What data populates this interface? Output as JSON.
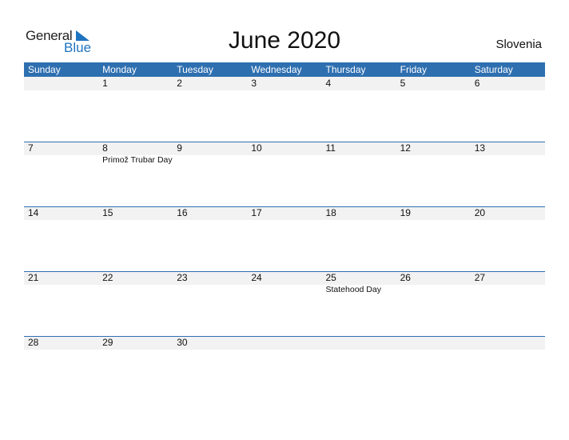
{
  "logo": {
    "general": "General",
    "blue": "Blue"
  },
  "header": {
    "title": "June 2020",
    "country": "Slovenia"
  },
  "colors": {
    "accent": "#2e6fb0",
    "band": "#f2f2f2",
    "logo_blue": "#1e74c0"
  },
  "weekdays": [
    "Sunday",
    "Monday",
    "Tuesday",
    "Wednesday",
    "Thursday",
    "Friday",
    "Saturday"
  ],
  "weeks": [
    [
      {
        "d": ""
      },
      {
        "d": "1"
      },
      {
        "d": "2"
      },
      {
        "d": "3"
      },
      {
        "d": "4"
      },
      {
        "d": "5"
      },
      {
        "d": "6"
      }
    ],
    [
      {
        "d": "7"
      },
      {
        "d": "8",
        "e": "Primož Trubar Day"
      },
      {
        "d": "9"
      },
      {
        "d": "10"
      },
      {
        "d": "11"
      },
      {
        "d": "12"
      },
      {
        "d": "13"
      }
    ],
    [
      {
        "d": "14"
      },
      {
        "d": "15"
      },
      {
        "d": "16"
      },
      {
        "d": "17"
      },
      {
        "d": "18"
      },
      {
        "d": "19"
      },
      {
        "d": "20"
      }
    ],
    [
      {
        "d": "21"
      },
      {
        "d": "22"
      },
      {
        "d": "23"
      },
      {
        "d": "24"
      },
      {
        "d": "25",
        "e": "Statehood Day"
      },
      {
        "d": "26"
      },
      {
        "d": "27"
      }
    ],
    [
      {
        "d": "28"
      },
      {
        "d": "29"
      },
      {
        "d": "30"
      },
      {
        "d": ""
      },
      {
        "d": ""
      },
      {
        "d": ""
      },
      {
        "d": ""
      }
    ]
  ]
}
